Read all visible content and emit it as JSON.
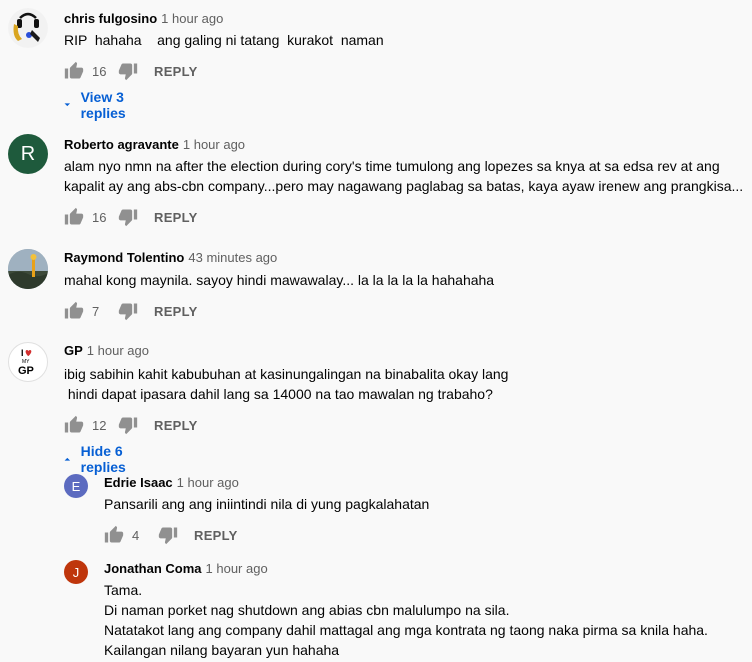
{
  "comments": [
    {
      "author": "chris fulgosino",
      "time": "1 hour ago",
      "text_lines": [
        "RIP  hahaha    ang galing ni tatang  kurakot  naman"
      ],
      "likes": "16",
      "reply_label": "REPLY",
      "avatar": {
        "type": "image",
        "icon": "saxophone-headphones-avatar"
      },
      "replies_toggle": "View 3 replies"
    },
    {
      "author": "Roberto agravante",
      "time": "1 hour ago",
      "text_lines": [
        "alam nyo nmn na after the election during cory's time tumulong ang lopezes sa knya at sa edsa rev at ang",
        "kapalit ay ang abs-cbn company...pero may nagawang paglabag sa batas, kaya ayaw irenew ang prangkisa..."
      ],
      "likes": "16",
      "reply_label": "REPLY",
      "avatar": {
        "type": "letter",
        "letter": "R",
        "color": "#1e5a3c"
      }
    },
    {
      "author": "Raymond Tolentino",
      "time": "43 minutes ago",
      "text_lines": [
        "mahal kong maynila. sayoy hindi mawawalay... la la la la la hahahaha"
      ],
      "likes": "7",
      "reply_label": "REPLY",
      "avatar": {
        "type": "image",
        "icon": "landscape-photo-avatar"
      }
    },
    {
      "author": "GP",
      "time": "1 hour ago",
      "text_lines": [
        "ibig sabihin kahit kabubuhan at kasinungalingan na binabalita okay lang",
        " hindi dapat ipasara dahil lang sa 14000 na tao mawalan ng trabaho?"
      ],
      "likes": "12",
      "reply_label": "REPLY",
      "avatar": {
        "type": "image",
        "icon": "i-love-my-gp-avatar",
        "line1": "I",
        "line2": "MY",
        "line3": "GP"
      },
      "replies_toggle": "Hide 6 replies"
    }
  ],
  "replies": [
    {
      "author": "Edrie Isaac",
      "time": "1 hour ago",
      "text_lines": [
        "Pansarili ang ang iniintindi nila di yung pagkalahatan"
      ],
      "likes": "4",
      "reply_label": "REPLY",
      "avatar": {
        "type": "letter",
        "letter": "E",
        "color": "#5c6bc0"
      }
    },
    {
      "author": "Jonathan Coma",
      "time": "1 hour ago",
      "text_lines": [
        "Tama.",
        "Di naman porket nag shutdown ang abias cbn malulumpo na sila.",
        "Natatakot lang ang company dahil mattagal ang mga kontrata ng taong naka pirma sa knila haha.",
        "Kailangan nilang bayaran yun hahaha"
      ],
      "avatar": {
        "type": "letter",
        "letter": "J",
        "color": "#bf360c"
      }
    }
  ],
  "colors": {
    "link": "#065fd4",
    "secondary": "#606060",
    "text": "#030303",
    "background": "#f9f9f9"
  }
}
